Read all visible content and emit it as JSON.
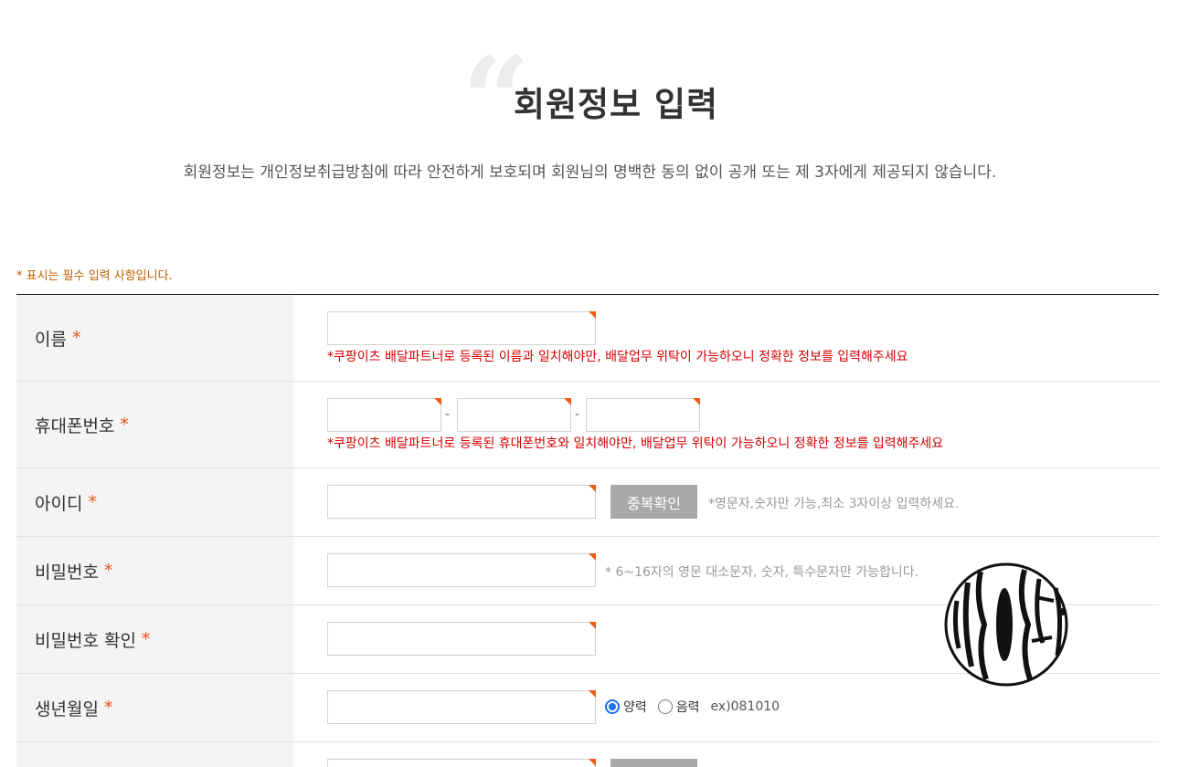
{
  "header": {
    "quote_glyph": "“",
    "title": "회원정보 입력",
    "subtitle": "회원정보는 개인정보취급방침에 따라 안전하게 보호되며 회원님의 명백한 동의 없이 공개 또는 제 3자에게 제공되지 않습니다."
  },
  "required_note": "* 표시는 필수 입력 사항입니다.",
  "required_star": "*",
  "rows": {
    "name": {
      "label": "이름",
      "warning": "*쿠팡이츠 배달파트너로 등록된 이름과 일치해야만, 배달업무 위탁이 가능하오니 정확한 정보를 입력해주세요"
    },
    "phone": {
      "label": "휴대폰번호",
      "separator": "-",
      "warning": "*쿠팡이츠 배달파트너로 등록된 휴대폰번호와 일치해야만, 배달업무 위탁이 가능하오니 정확한 정보를 입력해주세요"
    },
    "userid": {
      "label": "아이디",
      "button": "중복확인",
      "hint": "*영문자,숫자만 가능,최소 3자이상 입력하세요."
    },
    "password": {
      "label": "비밀번호",
      "hint": "* 6~16자의 영문 대소문자, 숫자, 특수문자만 가능합니다."
    },
    "password_confirm": {
      "label": "비밀번호 확인"
    },
    "birthday": {
      "label": "생년월일",
      "option_solar": "양력",
      "option_lunar": "음력",
      "selected": "양력",
      "example": "ex)081010"
    }
  },
  "colors": {
    "accent": "#ee5a12",
    "warning": "#d60000",
    "required_note": "#c15f00",
    "button": "#a9a9a9",
    "label_bg": "#f4f4f4"
  }
}
